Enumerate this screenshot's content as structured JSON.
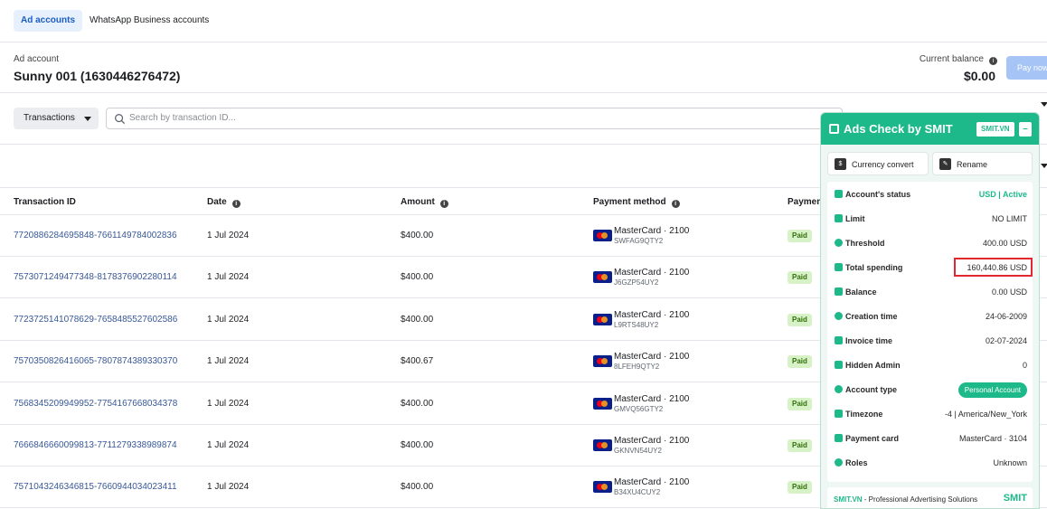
{
  "tabs": [
    "Ad accounts",
    "WhatsApp Business accounts"
  ],
  "account": {
    "label": "Ad account",
    "name": "Sunny 001 (1630446276472)"
  },
  "balance": {
    "label": "Current balance",
    "value": "$0.00",
    "pay_label": "Pay now"
  },
  "filters": {
    "dropdown_label": "Transactions",
    "search_placeholder": "Search by transaction ID..."
  },
  "table": {
    "columns": [
      "Transaction ID",
      "Date",
      "Amount",
      "Payment method",
      "Payment"
    ],
    "rows": [
      {
        "id": "7720886284695848-7661149784002836",
        "date": "1 Jul 2024",
        "amount": "$400.00",
        "method": "MasterCard · 2100",
        "code": "SWFAG9QTY2",
        "status": "Paid"
      },
      {
        "id": "7573071249477348-8178376902280114",
        "date": "1 Jul 2024",
        "amount": "$400.00",
        "method": "MasterCard · 2100",
        "code": "J6GZP54UY2",
        "status": "Paid"
      },
      {
        "id": "7723725141078629-7658485527602586",
        "date": "1 Jul 2024",
        "amount": "$400.00",
        "method": "MasterCard · 2100",
        "code": "L9RTS48UY2",
        "status": "Paid"
      },
      {
        "id": "7570350826416065-7807874389330370",
        "date": "1 Jul 2024",
        "amount": "$400.67",
        "method": "MasterCard · 2100",
        "code": "8LFEH9QTY2",
        "status": "Paid"
      },
      {
        "id": "7568345209949952-7754167668034378",
        "date": "1 Jul 2024",
        "amount": "$400.00",
        "method": "MasterCard · 2100",
        "code": "GMVQ56GTY2",
        "status": "Paid"
      },
      {
        "id": "7666846660099813-7711279338989874",
        "date": "1 Jul 2024",
        "amount": "$400.00",
        "method": "MasterCard · 2100",
        "code": "GKNVN54UY2",
        "status": "Paid"
      },
      {
        "id": "7571043246346815-7660944034023411",
        "date": "1 Jul 2024",
        "amount": "$400.00",
        "method": "MasterCard · 2100",
        "code": "B34XU4CUY2",
        "status": "Paid"
      }
    ]
  },
  "panel": {
    "title": "Ads Check by SMIT",
    "badge": "SMIT.VN",
    "minimize": "–",
    "btn_currency": "Currency convert",
    "btn_rename": "Rename",
    "items": [
      {
        "label": "Account's status",
        "value": "USD | Active"
      },
      {
        "label": "Limit",
        "value": "NO LIMIT"
      },
      {
        "label": "Threshold",
        "value": "400.00 USD"
      },
      {
        "label": "Total spending",
        "value": "160,440.86 USD"
      },
      {
        "label": "Balance",
        "value": "0.00 USD"
      },
      {
        "label": "Creation time",
        "value": "24-06-2009"
      },
      {
        "label": "Invoice time",
        "value": "02-07-2024"
      },
      {
        "label": "Hidden Admin",
        "value": "0"
      },
      {
        "label": "Account type",
        "value": "Personal Account"
      },
      {
        "label": "Timezone",
        "value": "-4 | America/New_York"
      },
      {
        "label": "Payment card",
        "value": "MasterCard · 3104"
      },
      {
        "label": "Roles",
        "value": "Unknown"
      }
    ],
    "footer_brand": "SMIT.VN",
    "footer_text": " - Professional Advertising Solutions",
    "footer_logo": "SMIT"
  }
}
